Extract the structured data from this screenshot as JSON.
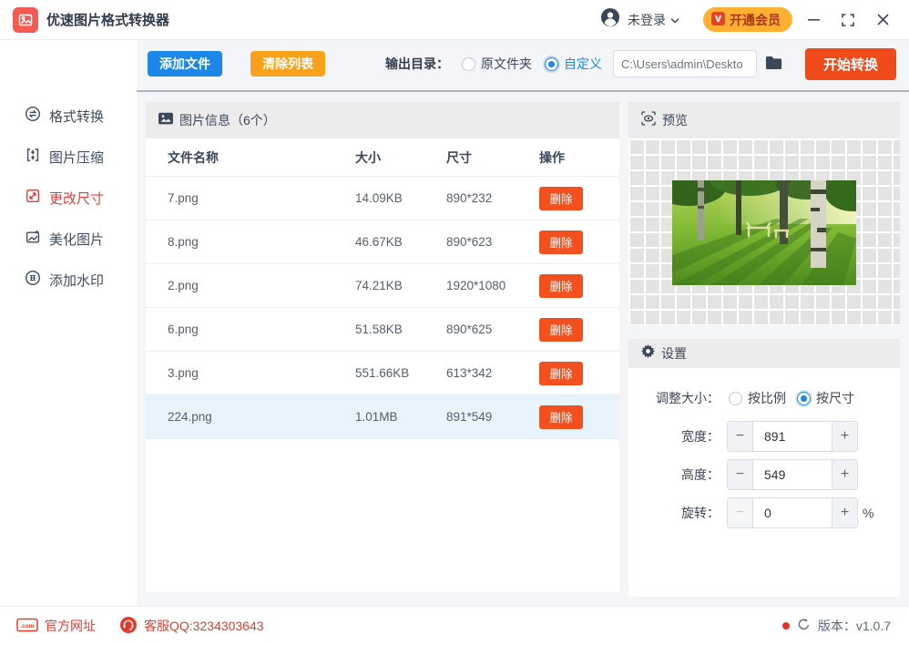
{
  "titlebar": {
    "app_title": "优速图片格式转换器",
    "login_label": "未登录",
    "vip_label": "开通会员"
  },
  "toolbar": {
    "add_files": "添加文件",
    "clear_list": "清除列表",
    "output_dir_label": "输出目录：",
    "radio_source_folder": "原文件夹",
    "radio_custom": "自定义",
    "output_path": "C:\\Users\\admin\\Deskto",
    "start_convert": "开始转换"
  },
  "sidebar": {
    "items": [
      {
        "label": "格式转换",
        "active": false
      },
      {
        "label": "图片压缩",
        "active": false
      },
      {
        "label": "更改尺寸",
        "active": true
      },
      {
        "label": "美化图片",
        "active": false
      },
      {
        "label": "添加水印",
        "active": false
      }
    ]
  },
  "file_panel": {
    "header": "图片信息（6个）",
    "columns": {
      "name": "文件名称",
      "size": "大小",
      "dims": "尺寸",
      "action": "操作"
    },
    "delete_label": "删除",
    "rows": [
      {
        "name": "7.png",
        "size": "14.09KB",
        "dims": "890*232",
        "selected": false
      },
      {
        "name": "8.png",
        "size": "46.67KB",
        "dims": "890*623",
        "selected": false
      },
      {
        "name": "2.png",
        "size": "74.21KB",
        "dims": "1920*1080",
        "selected": false
      },
      {
        "name": "6.png",
        "size": "51.58KB",
        "dims": "890*625",
        "selected": false
      },
      {
        "name": "3.png",
        "size": "551.66KB",
        "dims": "613*342",
        "selected": false
      },
      {
        "name": "224.png",
        "size": "1.01MB",
        "dims": "891*549",
        "selected": true
      }
    ]
  },
  "preview": {
    "header": "预览"
  },
  "settings": {
    "header": "设置",
    "resize_label": "调整大小：",
    "radio_ratio": "按比例",
    "radio_size": "按尺寸",
    "width_label": "宽度：",
    "width_value": "891",
    "height_label": "高度：",
    "height_value": "549",
    "rotate_label": "旋转：",
    "rotate_value": "0",
    "rotate_unit": "%",
    "minus_glyph": "−",
    "plus_glyph": "+"
  },
  "footer": {
    "website": "官方网址",
    "qq": "客服QQ:3234303643",
    "version": "版本：v1.0.7"
  },
  "icons": {
    "app-logo-icon": "red rounded square with white picture glyph",
    "user-icon": "dark person circle",
    "chevron-down-icon": "v chevron",
    "vip-badge-icon": "red square white V",
    "minimize-icon": "horizontal bar",
    "maximize-icon": "corner brackets",
    "close-icon": "x cross",
    "convert-icon": "circle with swap arrows",
    "compress-icon": "brackets with inward arrows",
    "resize-icon": "square with diagonal arrow",
    "beautify-icon": "picture with sparkle",
    "watermark-icon": "circle stamp",
    "picture-info-icon": "dark picture glyph",
    "preview-eye-icon": "eye in scan brackets",
    "gear-icon": "dark gear",
    "folder-icon": "dark folder",
    "dotcom-icon": "red .com box",
    "service-icon": "red headset circle",
    "refresh-icon": "circular arrow",
    "status-dot": "red dot"
  },
  "colors": {
    "accent_blue": "#1c87e8",
    "accent_orange": "#f9a11a",
    "accent_red": "#ee4a1a",
    "delete_red": "#f2511f",
    "sidebar_active": "#e23d3d",
    "vip_bg": "#ffb032",
    "selected_row_bg": "#e7f4fc",
    "panel_header_bg": "#ececec",
    "main_bg": "#f3f5f8"
  }
}
